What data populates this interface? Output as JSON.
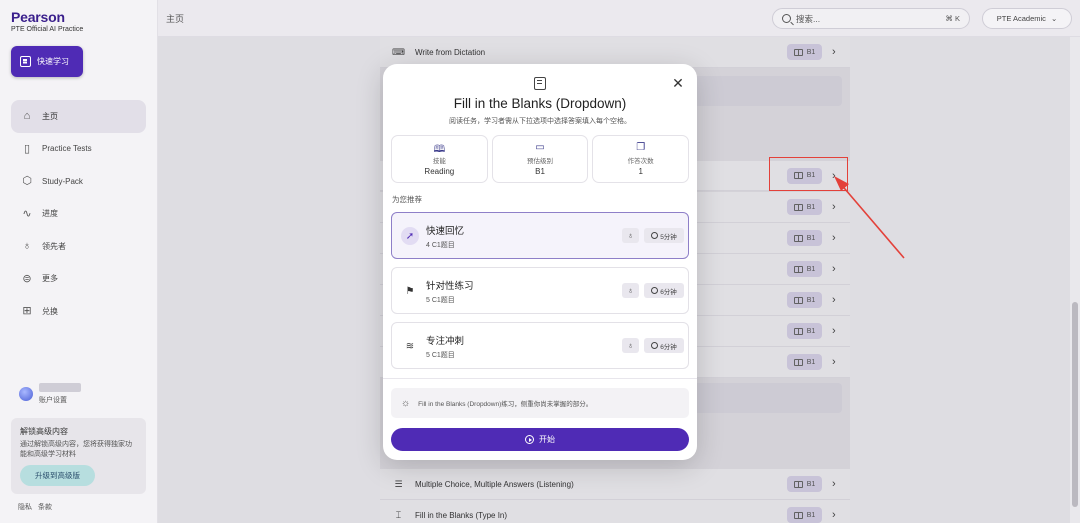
{
  "brand": {
    "name": "Pearson",
    "subtitle": "PTE Official AI Practice"
  },
  "sidebar": {
    "quick_button": "快速学习",
    "items": [
      {
        "label": "主页",
        "icon": "home-icon"
      },
      {
        "label": "Practice Tests",
        "icon": "clipboard-icon"
      },
      {
        "label": "Study-Pack",
        "icon": "package-icon"
      },
      {
        "label": "进度",
        "icon": "progress-icon"
      },
      {
        "label": "领先者",
        "icon": "medal-icon"
      },
      {
        "label": "更多",
        "icon": "more-icon"
      },
      {
        "label": "兑换",
        "icon": "gift-icon"
      }
    ],
    "user_sub": "账户设置",
    "upgrade": {
      "title": "解锁高级内容",
      "desc": "通过解锁高级内容，您将获得独家功能和高级学习材料",
      "button": "升级到高级版"
    },
    "footer": [
      "隐私",
      "条款"
    ]
  },
  "topbar": {
    "title": "主页",
    "search_placeholder": "搜索...",
    "search_kbd": "⌘ K",
    "exam": "PTE Academic"
  },
  "list": {
    "badge": "B1",
    "first_row": "Write from Dictation",
    "bottom_rows": [
      "Multiple Choice, Multiple Answers (Listening)",
      "Fill in the Blanks (Type In)"
    ]
  },
  "modal": {
    "title": "Fill in the Blanks (Dropdown)",
    "desc": "阅读任务，学习者需从下拉选项中选择答案填入每个空格。",
    "stats": [
      {
        "label": "技能",
        "value": "Reading",
        "icon": "book-open-icon"
      },
      {
        "label": "预估级别",
        "value": "B1",
        "icon": "level-book-icon"
      },
      {
        "label": "作答次数",
        "value": "1",
        "icon": "copy-icon"
      }
    ],
    "recommend_label": "为您推荐",
    "recommendations": [
      {
        "name": "快速回忆",
        "sub": "4 C1题目",
        "time": "5分钟",
        "icon": "rocket-icon"
      },
      {
        "name": "针对性练习",
        "sub": "5 C1题目",
        "time": "6分钟",
        "icon": "golf-flag-icon"
      },
      {
        "name": "专注冲刺",
        "sub": "5 C1题目",
        "time": "6分钟",
        "icon": "wave-icon"
      }
    ],
    "tip": "Fill in the Blanks (Dropdown)练习，侧重你尚未掌握的部分。",
    "start_button": "开始"
  },
  "colors": {
    "accent": "#4f2bb5",
    "annotation": "#e3413a"
  }
}
